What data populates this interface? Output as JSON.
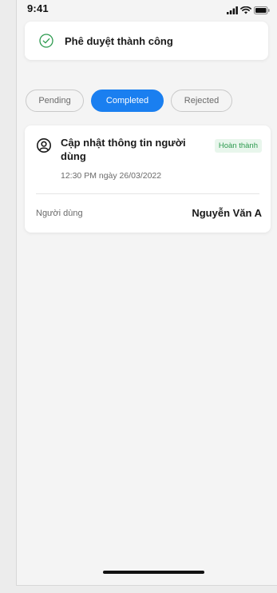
{
  "status_bar": {
    "time": "9:41",
    "icons": [
      "signal-icon",
      "wifi-icon",
      "battery-icon"
    ]
  },
  "toast": {
    "icon": "check-circle-icon",
    "message": "Phê duyệt thành công"
  },
  "tabs": [
    {
      "label": "Pending",
      "selected": false
    },
    {
      "label": "Completed",
      "selected": true
    },
    {
      "label": "Rejected",
      "selected": false
    }
  ],
  "request_card": {
    "icon": "user-circle-icon",
    "title": "Cập nhật thông tin người dùng",
    "status_badge": "Hoàn thành",
    "timestamp": "12:30 PM ngày 26/03/2022",
    "user_label": "Người dùng",
    "user_value": "Nguyễn Văn A"
  },
  "colors": {
    "accent": "#1a7ff0",
    "success": "#2c9a4e",
    "success_bg": "#e8f6ec"
  }
}
